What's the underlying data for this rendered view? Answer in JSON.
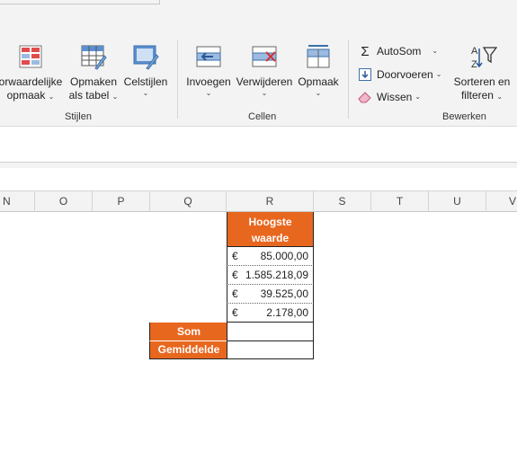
{
  "ribbon": {
    "stijlen": {
      "group_label": "Stijlen",
      "cond_format": {
        "line1": "orwaardelijke",
        "line2": "opmaak"
      },
      "format_table": {
        "line1": "Opmaken",
        "line2": "als tabel"
      },
      "cell_styles": {
        "line1": "Celstijlen"
      }
    },
    "cellen": {
      "group_label": "Cellen",
      "insert": "Invoegen",
      "delete": "Verwijderen",
      "format": "Opmaak"
    },
    "bewerken": {
      "group_label": "Bewerken",
      "autosum": "AutoSom",
      "fill": "Doorvoeren",
      "clear": "Wissen",
      "sort_filter": {
        "line1": "Sorteren en",
        "line2": "filteren"
      }
    }
  },
  "columns": [
    "N",
    "O",
    "P",
    "Q",
    "R",
    "S",
    "T",
    "U",
    "V"
  ],
  "table": {
    "header": {
      "line1": "Hoogste",
      "line2": "waarde"
    },
    "currency_symbol": "€",
    "values": [
      "85.000,00",
      "1.585.218,09",
      "39.525,00",
      "2.178,00"
    ],
    "sum_label": "Som",
    "avg_label": "Gemiddelde"
  },
  "colors": {
    "accent": "#e8671f",
    "ribbon_bg": "#f3f3f3"
  }
}
